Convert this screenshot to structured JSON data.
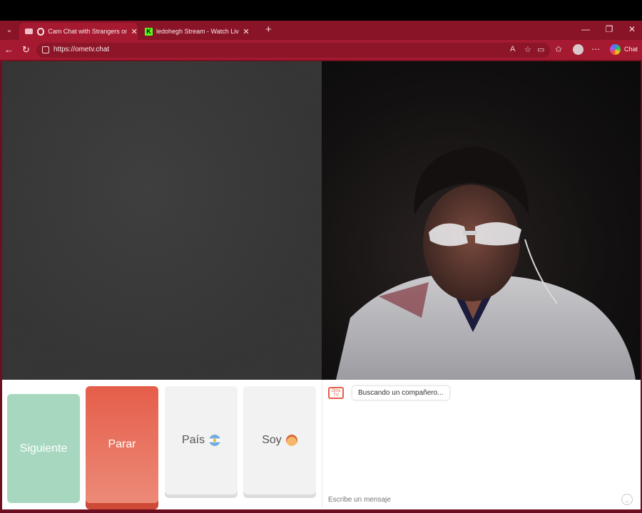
{
  "browser": {
    "tabs": [
      {
        "title": "Cam Chat with Strangers on OmeTV",
        "favicon": "omegle-icon",
        "active": true
      },
      {
        "title": "ledohegh Stream - Watch Live on Kick",
        "favicon": "kick-icon",
        "active": false
      }
    ],
    "new_tab_symbol": "+",
    "url": "https://ometv.chat",
    "chat_label": "Chat"
  },
  "controls": {
    "next_label": "Siguiente",
    "stop_label": "Parar",
    "country_label": "País",
    "soy_label": "Soy"
  },
  "chat": {
    "status_message": "Buscando un compañero...",
    "input_placeholder": "Escribe un mensaje",
    "logo_text": "Ome TV"
  },
  "colors": {
    "browser_theme": "#a51a30",
    "next_button": "#a7d8bf",
    "stop_button": "#e55e4a"
  }
}
